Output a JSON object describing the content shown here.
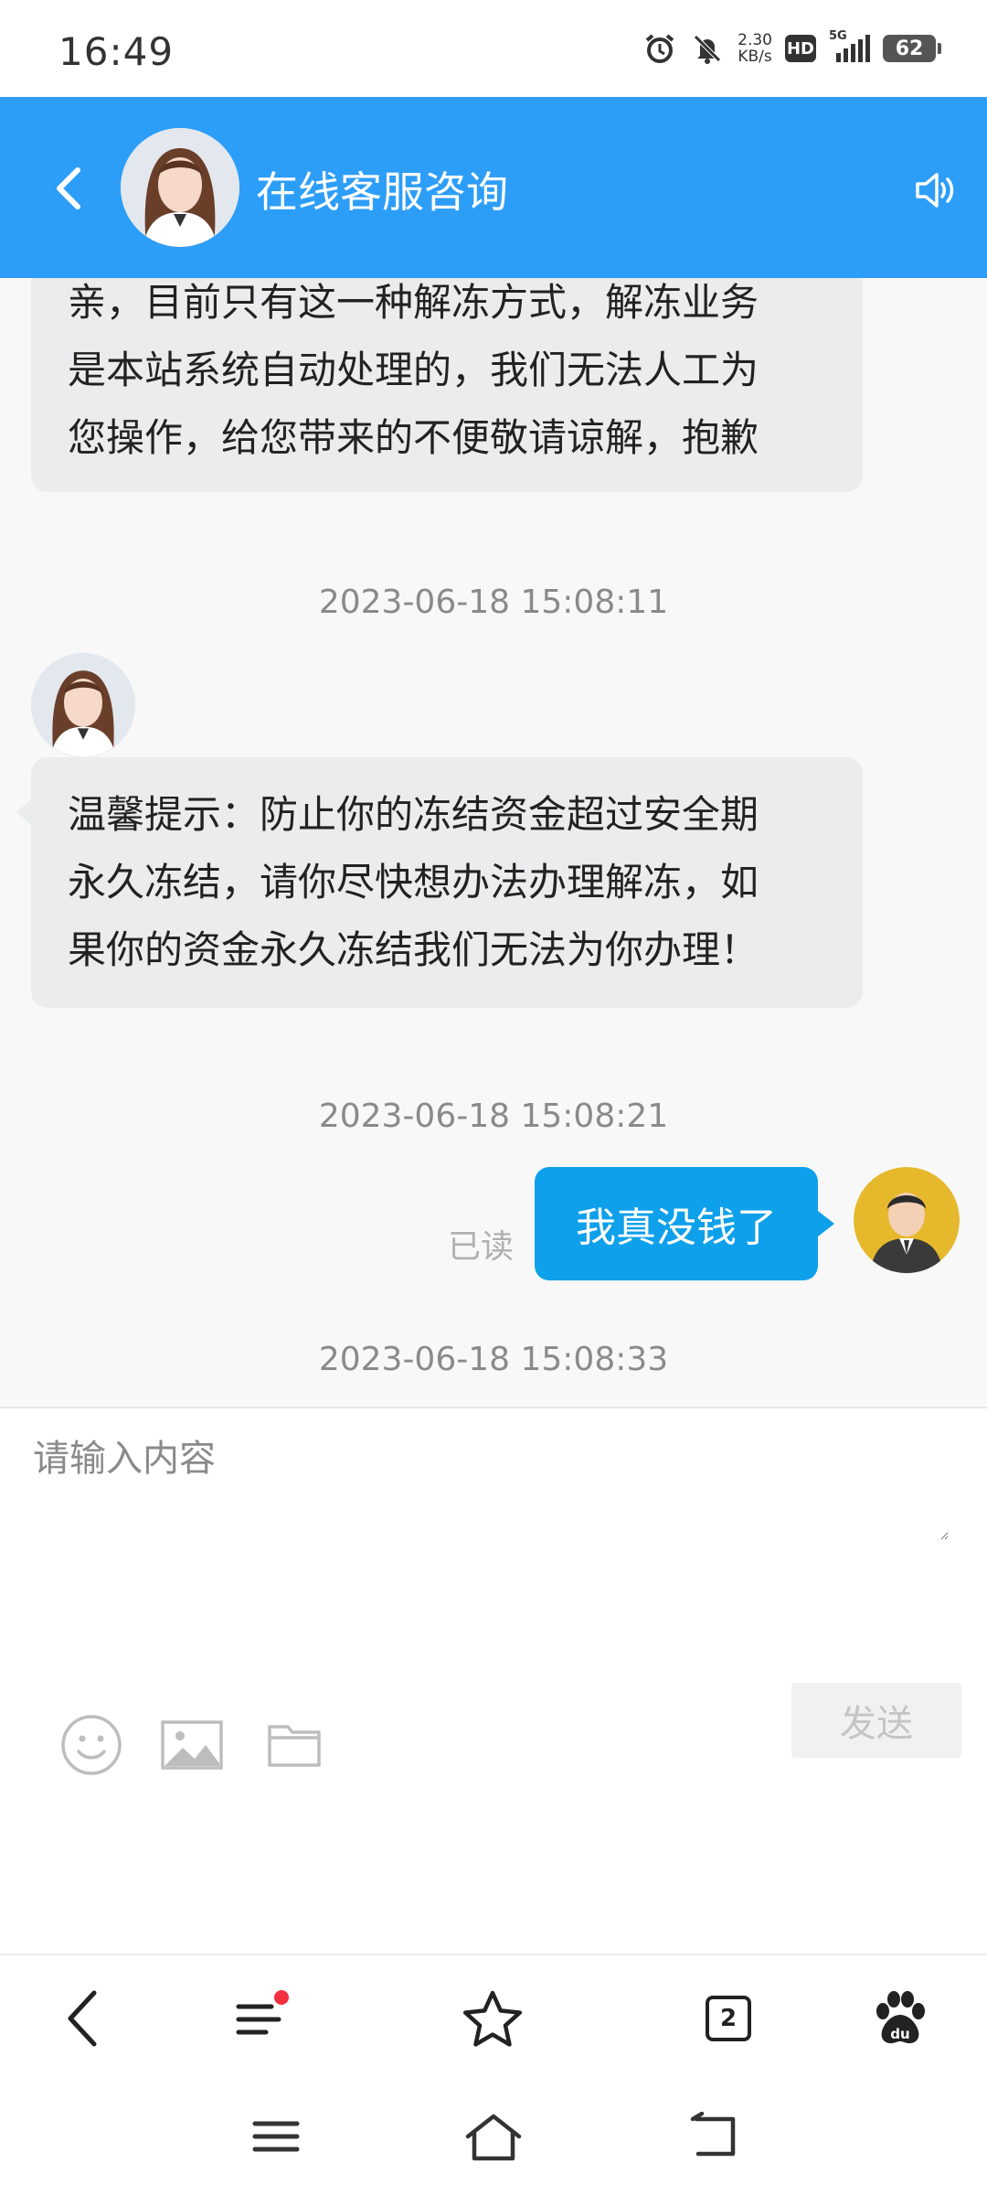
{
  "status_bar": {
    "time": "16:49",
    "net_speed_value": "2.30",
    "net_speed_unit": "KB/s",
    "hd_label": "HD",
    "network_label": "5G",
    "battery": "62"
  },
  "header": {
    "title": "在线客服咨询",
    "back_icon": "chevron-left-icon",
    "speaker_icon": "speaker-icon"
  },
  "chat": {
    "messages": [
      {
        "lines": [
          "亲，目前只有这一种解冻方式，解冻业务",
          "是本站系统自动处理的，我们无法人工为",
          "您操作，给您带来的不便敬请谅解，抱歉"
        ]
      },
      {
        "timestamp": "2023-06-18 15:08:11",
        "lines": [
          "温馨提示：防止你的冻结资金超过安全期",
          "永久冻结，请你尽快想办法办理解冻，如",
          "果你的资金永久冻结我们无法为你办理！"
        ]
      },
      {
        "timestamp": "2023-06-18 15:08:21",
        "text": "我真没钱了",
        "read_status": "已读"
      },
      {
        "timestamp": "2023-06-18 15:08:33"
      }
    ]
  },
  "input": {
    "placeholder": "请输入内容",
    "send_label": "发送",
    "tools": [
      "emoji-icon",
      "image-icon",
      "folder-icon"
    ]
  },
  "browser_toolbar": {
    "tab_count": "2",
    "items": [
      "back-icon",
      "menu-icon",
      "star-icon",
      "tabs-icon",
      "baidu-paw-icon"
    ]
  },
  "system_nav": {
    "items": [
      "recent-apps-icon",
      "home-icon",
      "back-icon"
    ]
  },
  "colors": {
    "header": "#2d9ef8",
    "outgoing_bubble": "#0ea0ea",
    "incoming_bubble": "#ebeced",
    "notification_dot": "#f23040"
  }
}
